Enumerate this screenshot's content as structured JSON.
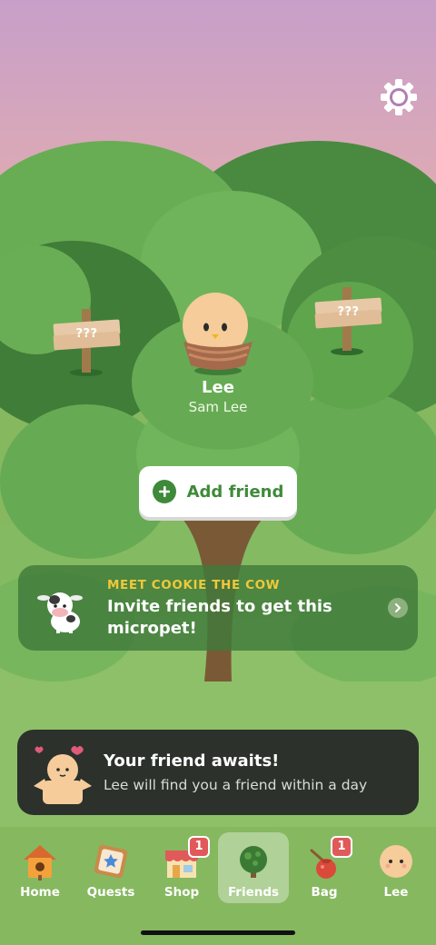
{
  "signs": {
    "left_text": "???",
    "right_text": "???"
  },
  "pet": {
    "name": "Lee",
    "owner": "Sam Lee"
  },
  "add_friend": {
    "label": "Add friend"
  },
  "invite_banner": {
    "kicker": "MEET COOKIE THE COW",
    "title": "Invite friends to get this micropet!"
  },
  "await_banner": {
    "title": "Your friend awaits!",
    "subtitle": "Lee will find you a friend within a day"
  },
  "tabs": [
    {
      "label": "Home",
      "icon": "birdhouse-icon",
      "badge": ""
    },
    {
      "label": "Quests",
      "icon": "quest-map-icon",
      "badge": ""
    },
    {
      "label": "Shop",
      "icon": "shop-icon",
      "badge": "1"
    },
    {
      "label": "Friends",
      "icon": "tree-icon",
      "badge": "",
      "active": true
    },
    {
      "label": "Bag",
      "icon": "bag-icon",
      "badge": "1"
    },
    {
      "label": "Lee",
      "icon": "pet-face-icon",
      "badge": ""
    }
  ],
  "colors": {
    "accent_green": "#3f8a3a",
    "badge_red": "#e05a5a",
    "kicker_yellow": "#f0c83a",
    "dark_card": "#2c312c"
  }
}
